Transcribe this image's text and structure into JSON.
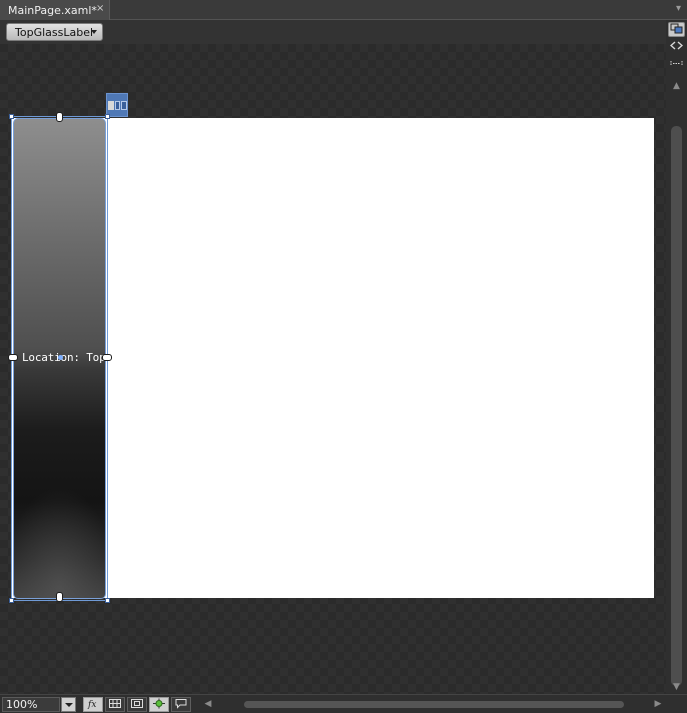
{
  "tab": {
    "title": "MainPage.xaml*",
    "close_glyph": "×",
    "overflow_glyph": "▾"
  },
  "breadcrumb": {
    "element_label": "TopGlassLabel"
  },
  "canvas": {
    "label_text": "Location: Top",
    "artboard_color": "#ffffff",
    "selection_color": "#6f9ad6"
  },
  "side_strip": {
    "icons": [
      "shape-view-icon",
      "code-view-icon",
      "split-view-icon"
    ]
  },
  "bottom": {
    "zoom_value": "100%",
    "tools": [
      "fx-icon",
      "snap-to-grid-icon",
      "snap-to-snaplines-icon",
      "artboard-effects-icon",
      "annotations-icon"
    ]
  }
}
